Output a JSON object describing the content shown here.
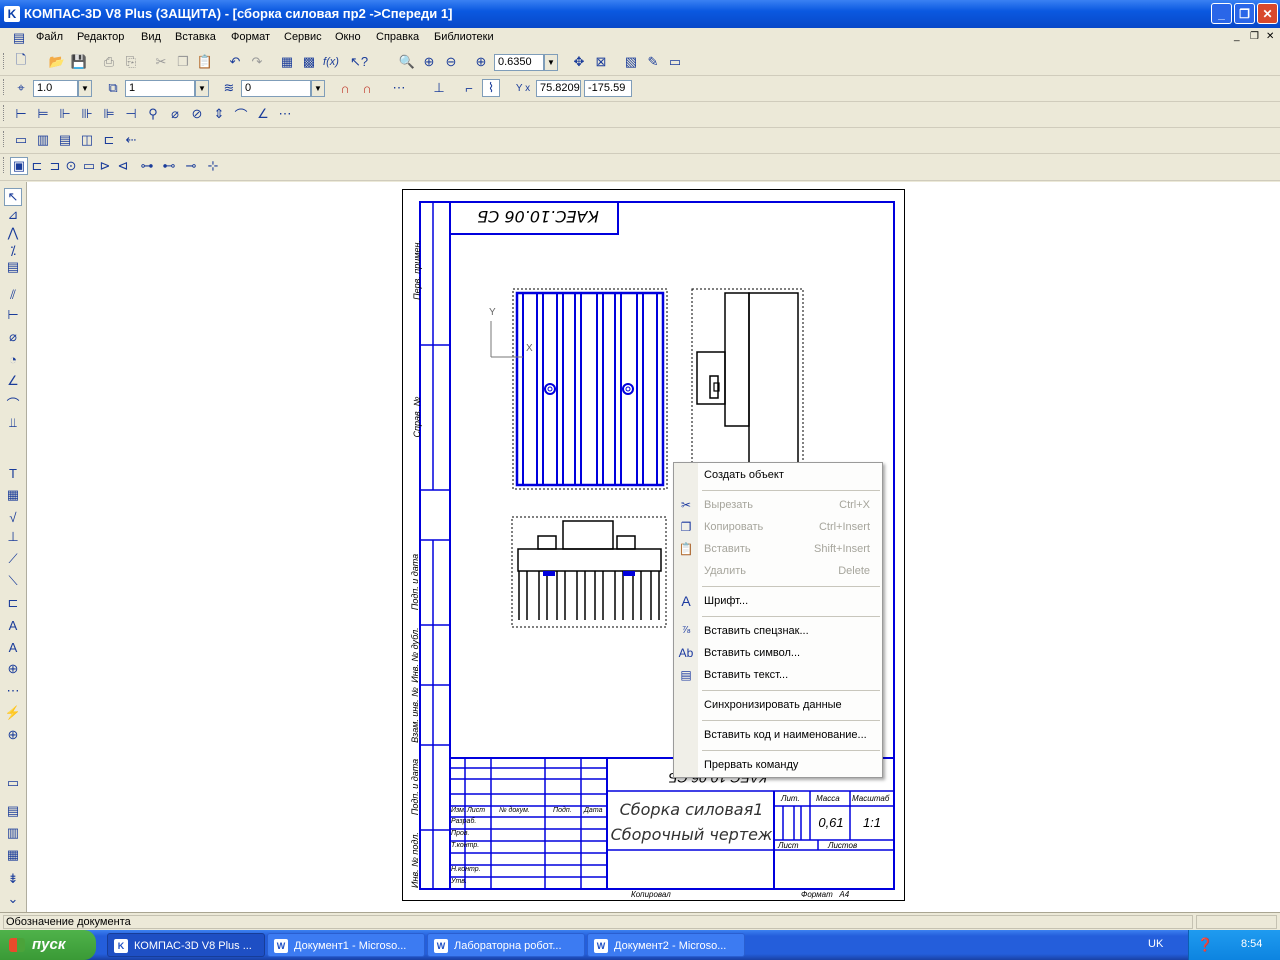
{
  "window": {
    "title": "КОМПАС-3D V8 Plus (ЗАЩИТА) - [сборка силовая пр2 ->Спереди 1]"
  },
  "menu": {
    "items": [
      "Файл",
      "Редактор",
      "Вид",
      "Вставка",
      "Формат",
      "Сервис",
      "Окно",
      "Справка",
      "Библиотеки"
    ]
  },
  "toolbar": {
    "zoom_value": "0.6350",
    "step_value": "1.0",
    "layer_value": "1",
    "style_value": "0",
    "coord_x": "75.8209",
    "coord_y": "-175.59"
  },
  "drawing": {
    "stamp_top": "КАЕС.10.06 СБ",
    "stamp_code": "КАЕС.10.06 СБ",
    "title_line1": "Сборка силовая1",
    "title_line2": "Сборочный чертеж",
    "mass": "0,61",
    "scale": "1:1",
    "col_lit": "Лит.",
    "col_massa": "Масса",
    "col_masshtab": "Масштаб",
    "sheet": "Лист",
    "sheets": "Листов",
    "kopiroval": "Копировал",
    "format": "Формат   А4",
    "axis_y": "Y",
    "axis_x": "X",
    "side_labels": [
      "Перв. примен.",
      "Справ. №",
      "Подп. и дата",
      "Инв. № дубл.",
      "Взам. инв. №",
      "Подп. и дата",
      "Инв. № подл."
    ],
    "row_labels": [
      "Изм.",
      "Лист",
      "№ докум.",
      "Подп.",
      "Дата",
      "Разраб.",
      "Пров.",
      "Т.контр.",
      "Н.контр.",
      "Утв."
    ]
  },
  "context_menu": {
    "create": "Создать объект",
    "cut": "Вырезать",
    "cut_sc": "Ctrl+X",
    "copy": "Копировать",
    "copy_sc": "Ctrl+Insert",
    "paste": "Вставить",
    "paste_sc": "Shift+Insert",
    "delete": "Удалить",
    "delete_sc": "Delete",
    "font": "Шрифт...",
    "special": "Вставить спецзнак...",
    "symbol": "Вставить символ...",
    "text": "Вставить текст...",
    "sync": "Синхронизировать данные",
    "code": "Вставить код и наименование...",
    "abort": "Прервать команду"
  },
  "status": {
    "text": "Обозначение документа"
  },
  "taskbar": {
    "start": "пуск",
    "tasks": [
      "КОМПАС-3D V8 Plus ...",
      "Документ1 - Microso...",
      "Лабораторна робот...",
      "Документ2 - Microso..."
    ],
    "lang": "UK",
    "time": "8:54"
  }
}
